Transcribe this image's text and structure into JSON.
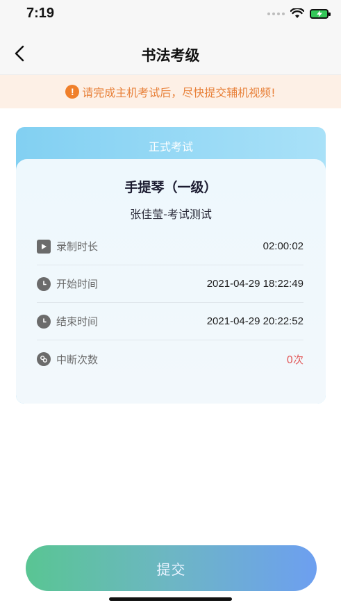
{
  "status_bar": {
    "time": "7:19"
  },
  "nav": {
    "title": "书法考级"
  },
  "notice": {
    "text": "请完成主机考试后，尽快提交辅机视频!"
  },
  "exam_card": {
    "header": "正式考试",
    "title": "手提琴（一级）",
    "subtitle": "张佳莹-考试测试",
    "rows": [
      {
        "icon": "play-icon",
        "label": "录制时长",
        "value": "02:00:02"
      },
      {
        "icon": "clock-icon",
        "label": "开始时间",
        "value": "2021-04-29 18:22:49"
      },
      {
        "icon": "clock-icon",
        "label": "结束时间",
        "value": "2021-04-29 20:22:52"
      },
      {
        "icon": "link-icon",
        "label": "中断次数",
        "value": "0次"
      }
    ]
  },
  "submit": {
    "label": "提交"
  },
  "colors": {
    "accent_orange": "#f07f2a",
    "interrupt_red": "#e25a5a",
    "card_header": "#82d0f2"
  }
}
